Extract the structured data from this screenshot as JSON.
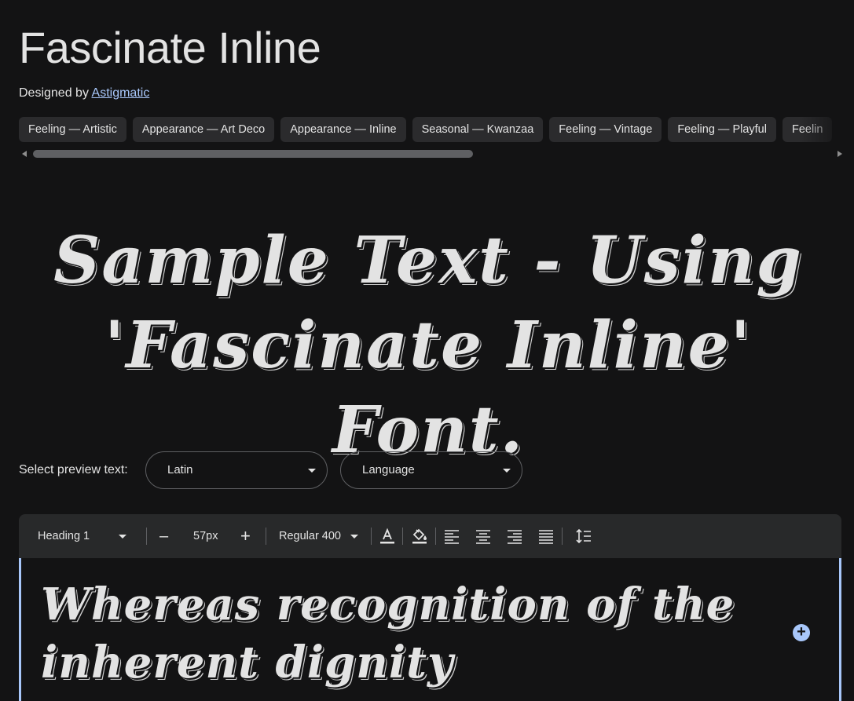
{
  "font": {
    "name": "Fascinate Inline",
    "designed_by_prefix": "Designed by",
    "designer": "Astigmatic"
  },
  "tags": [
    "Feeling — Artistic",
    "Appearance — Art Deco",
    "Appearance — Inline",
    "Seasonal — Kwanzaa",
    "Feeling — Vintage",
    "Feeling — Playful",
    "Feelin"
  ],
  "sample_text": "Sample Text - Using 'Fascinate Inline' Font.",
  "preview": {
    "label": "Select preview text:",
    "script_value": "Latin",
    "language_value": "Language"
  },
  "toolbar": {
    "style_value": "Heading 1",
    "decrease_label": "–",
    "size_value": "57px",
    "increase_label": "+",
    "weight_value": "Regular 400"
  },
  "editor": {
    "text": "Whereas recognition of the inherent dignity",
    "add_label": "+"
  },
  "colors": {
    "background": "#131314",
    "toolbar": "#28292a",
    "accent": "#a8c7fa",
    "chip": "#2b2b2d"
  }
}
